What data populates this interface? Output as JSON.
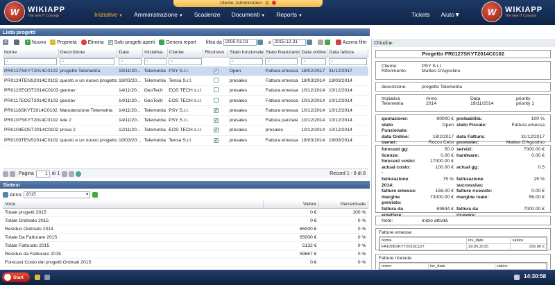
{
  "app": {
    "logo_text": "WIKIAPP",
    "logo_tag": "The new IT Concept",
    "user": "Utente: Administrator"
  },
  "menu": [
    {
      "label": "Iniziative",
      "caret": true,
      "active": true
    },
    {
      "label": "Amministrazione",
      "caret": true
    },
    {
      "label": "Scadenze",
      "caret": false
    },
    {
      "label": "Documenti",
      "caret": true
    },
    {
      "label": "Reports",
      "caret": true
    }
  ],
  "menu_right": [
    {
      "label": "Tickets"
    },
    {
      "label": "Aiuto",
      "caret": true
    }
  ],
  "list": {
    "title": "Lista progetti",
    "toolbar": {
      "nuovo": "Nuovo",
      "proprieta": "Proprietà",
      "elimina": "Elimina",
      "solo_aperti": "Solo progetti aperti",
      "genera": "Genera report",
      "filtra_da": "filtra da",
      "da_val": "2005-01-01",
      "a": "a",
      "a_val": "2015-12-31",
      "azzera": "Azzera filtri"
    },
    "columns": [
      "Nome",
      "Descrizione",
      "Data",
      "Iniziativa",
      "Cliente",
      "Ricorsivo",
      "Stato funzionale",
      "Stato finanziario",
      "Data ordine",
      "Data fattura"
    ],
    "rows": [
      [
        "PR0127SKYT2014C0102",
        "progetto Telemetria",
        "19/11/20...",
        "Telemetria",
        "PSY S.r.l.",
        true,
        "Open",
        "Fattura emessa",
        "18/02/2017",
        "31/12/2017"
      ],
      [
        "PR0124TENS2014C0102",
        "questo e un nuovo progetto",
        "18/03/20...",
        "Telemetria",
        "Tensa S.r.l.",
        false,
        "presales",
        "Fattura emessa",
        "18/03/2014",
        "18/03/2014"
      ],
      [
        "PR0122EOST2014C0103",
        "geonav",
        "14/11/20...",
        "GeoTech",
        "EOS TECH s.r.l",
        false,
        "presales",
        "Fattura emessa",
        "10/12/2014",
        "10/12/2014"
      ],
      [
        "PR0117EOST2014C0103",
        "geonav",
        "14/11/20...",
        "GeoTech",
        "EOS TECH s.r.l",
        false,
        "presales",
        "Fattura emessa",
        "10/12/2014",
        "10/12/2014"
      ],
      [
        "PR0116SKYT2014C0102",
        "Manutenzione Telemetria",
        "14/11/20...",
        "Telemetria",
        "PSY S.r.l.",
        true,
        "presales",
        "Fattura emessa",
        "10/12/2014",
        "10/12/2014"
      ],
      [
        "PR0107SKYT2014C0102",
        "tele 2",
        "14/11/20...",
        "Telemetria",
        "PSY S.r.l.",
        true,
        "presales",
        "Fattura parziale",
        "10/12/2014",
        "10/12/2014"
      ],
      [
        "PR0104EOST2014C0102",
        "prova 2",
        "12/11/20...",
        "Telemetria",
        "EOS TECH s.r.l",
        true,
        "presales",
        "presales",
        "10/12/2014",
        "10/12/2014"
      ],
      [
        "PR0103TENS2014C0102",
        "questo e un nuovo progetto",
        "18/03/20...",
        "Telemetria",
        "Tensa S.r.l.",
        true,
        "presales",
        "Fattura emessa",
        "18/03/2014",
        "18/03/2014"
      ]
    ],
    "pager": {
      "pagina": "Pagina",
      "page": "1",
      "di": "di 1",
      "record": "Record 1 - 8 di 8"
    }
  },
  "sintesi": {
    "title": "Sintesi",
    "anno_label": "Anno:",
    "anno": "2015",
    "columns": [
      "Voce",
      "Valore",
      "Percentuale"
    ],
    "rows": [
      [
        "Totale progetti 2015",
        "0 €",
        "100 %"
      ],
      [
        "Totale Ordinato 2015",
        "0 €",
        "0 %"
      ],
      [
        "Residuo Ordinato 2014",
        "65000 €",
        "0 %"
      ],
      [
        "Totale Da Fatturare 2015",
        "65000 €",
        "0 %"
      ],
      [
        "Totale Fatturato 2015",
        "5132 €",
        "0 %"
      ],
      [
        "Residuo da Fatturare 2015",
        "59867 €",
        "0 %"
      ],
      [
        "Forecast Costo dei progetti Ordinati 2015",
        "0 €",
        "0 %"
      ]
    ]
  },
  "detail": {
    "chiudi": "Chiudi",
    "title": "Progetto PR0127SKYT2014C0102",
    "cliente_l": "Cliente:",
    "cliente": "PSY S.r.l.",
    "rif_l": "Riferimento:",
    "rif": "Matteo D'Agostino",
    "descr_l": "descrizione:",
    "descr": "progetto Telemetria",
    "h": [
      "Iniziativa",
      "Anno",
      "Data",
      "priority"
    ],
    "v": [
      "Telemetria",
      "2014",
      "19/11/2014",
      "priority 1"
    ],
    "kv1": [
      [
        "quotazione:",
        "90000 €",
        "probabilità:",
        "100 %"
      ],
      [
        "stato Funzionale:",
        "Open",
        "stato Fiscale:",
        "Fattura emessa"
      ],
      [
        "data Ordine:",
        "18/2/2017",
        "data Fattura:",
        "31/12/2017"
      ],
      [
        "owner:",
        "Rocco Celsi",
        "promoter:",
        "Matteo D'Agostino"
      ]
    ],
    "kv2": [
      [
        "forecast gg:",
        "50.0",
        "servizi:",
        "7000.00 €"
      ],
      [
        "licenze:",
        "0.00 €",
        "hardware:",
        "0.00 €"
      ],
      [
        "forecast costo:",
        "17000.00 €",
        "",
        ""
      ],
      [
        "actual costo:",
        "100.00 €",
        "actual gg:",
        "0.5"
      ],
      [
        "-",
        "",
        "",
        ""
      ],
      [
        "fatturazione 2014:",
        "75 %",
        "fatturazione successiva:",
        "25 %"
      ],
      [
        "fatture emesse:",
        "156.00 €",
        "fatture ricevute:",
        "0.00 €"
      ],
      [
        "margine previsto:",
        "73000.00 €",
        "margine reale:",
        "56.00 €"
      ],
      [
        "fattura da emettere:",
        "89844 €",
        "fattura da ricevere:",
        "7000.00 €"
      ]
    ],
    "note_l": "Note:",
    "note": "Inizio attività",
    "fe_title": "Fatture emesse",
    "fe_cols": [
      "nome",
      "inv_date",
      "valore"
    ],
    "fe_row": [
      "FA1006SKYT2015C127",
      "29.05.2015",
      "156.00 €"
    ],
    "fr_title": "Fatture ricevute",
    "fr_cols": [
      "nome",
      "inv_date",
      "valore"
    ]
  },
  "taskbar": {
    "start": "Start",
    "clock": "14:30:58"
  }
}
